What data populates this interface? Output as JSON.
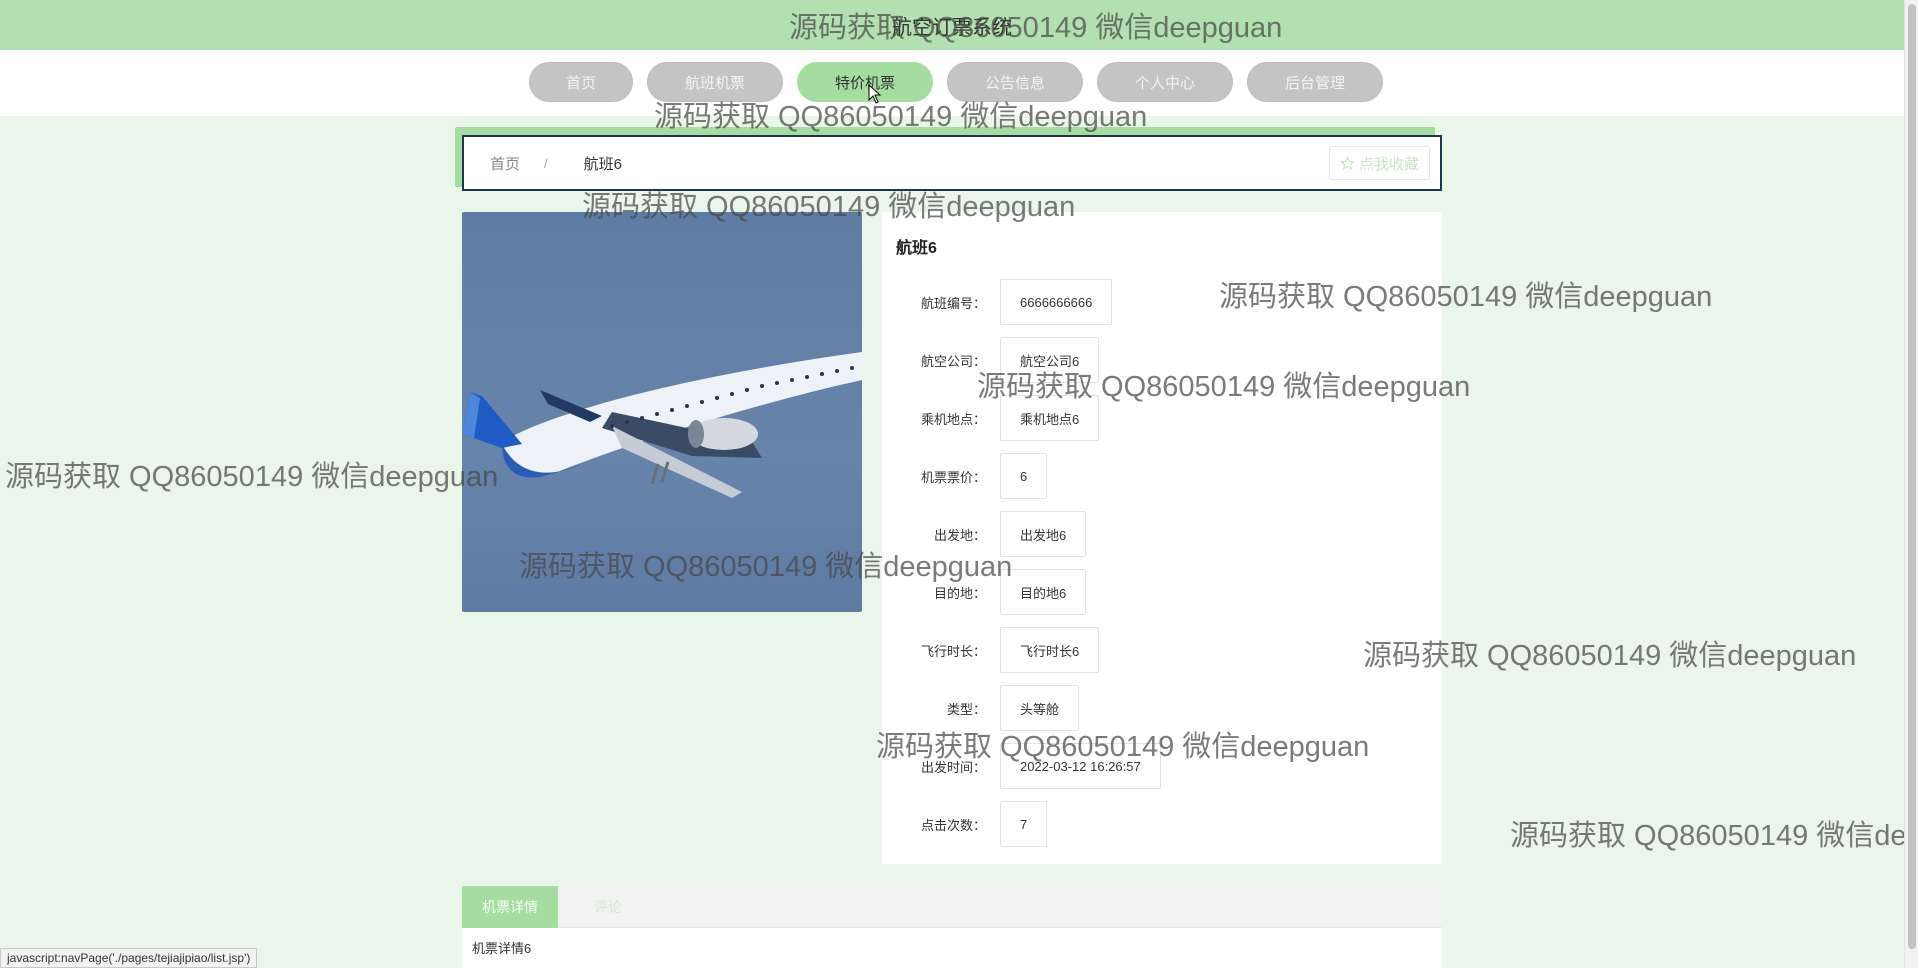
{
  "site": {
    "title": "航空订票系统"
  },
  "nav": {
    "items": [
      {
        "label": "首页",
        "active": false
      },
      {
        "label": "航班机票",
        "active": false
      },
      {
        "label": "特价机票",
        "active": true
      },
      {
        "label": "公告信息",
        "active": false
      },
      {
        "label": "个人中心",
        "active": false
      },
      {
        "label": "后台管理",
        "active": false
      }
    ]
  },
  "breadcrumb": {
    "home": "首页",
    "separator": "/",
    "current": "航班6",
    "favorite_label": "点我收藏",
    "favorite_icon": "star-outline-icon"
  },
  "detail": {
    "title": "航班6",
    "fields": [
      {
        "label": "航班编号：",
        "value": "6666666666"
      },
      {
        "label": "航空公司：",
        "value": "航空公司6"
      },
      {
        "label": "乘机地点：",
        "value": "乘机地点6"
      },
      {
        "label": "机票票价：",
        "value": "6"
      },
      {
        "label": "出发地：",
        "value": "出发地6"
      },
      {
        "label": "目的地：",
        "value": "目的地6"
      },
      {
        "label": "飞行时长：",
        "value": "飞行时长6"
      },
      {
        "label": "类型：",
        "value": "头等舱"
      },
      {
        "label": "出发时间：",
        "value": "2022-03-12 16:26:57"
      },
      {
        "label": "点击次数：",
        "value": "7"
      }
    ]
  },
  "tabs": [
    {
      "label": "机票详情",
      "active": true
    },
    {
      "label": "评论",
      "active": false
    }
  ],
  "tab_content": "机票详情6",
  "status_bar": "javascript:navPage('./pages/tejiajipiao/list.jsp')",
  "watermark": "源码获取 QQ86050149 微信deepguan",
  "colors": {
    "accent_green": "#a5dca0",
    "header_green": "#b2e0b0",
    "breadcrumb_border": "#1c3550",
    "nav_inactive": "#c4c4c4"
  }
}
